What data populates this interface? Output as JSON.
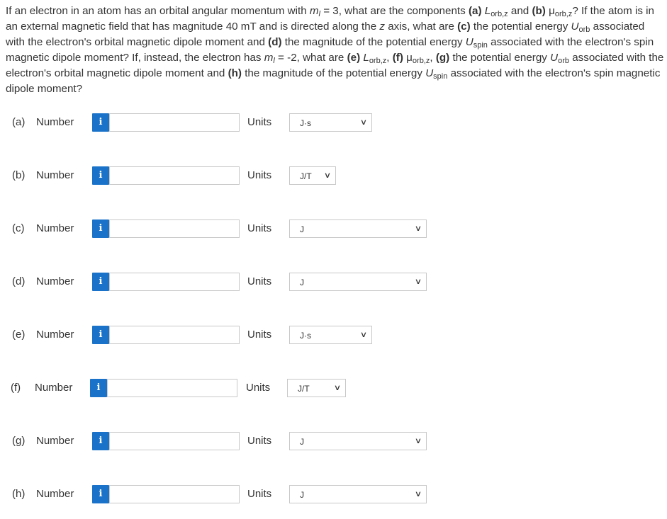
{
  "question": {
    "t1": "If an electron in an atom has an orbital angular momentum with ",
    "ml_sym": "m",
    "ml_sub": "l",
    "t2": " = 3, what are the components ",
    "a": "(a)",
    "L_sym": "L",
    "orbz_sub": "orb,z",
    "t3": " and ",
    "b": "(b)",
    "mu_sym": "μ",
    "t4": "? If the atom is in an external magnetic field that has magnitude 40 mT and is directed along the ",
    "z": "z",
    "t5": " axis, what are ",
    "c": "(c)",
    "t6": " the potential energy ",
    "U_sym": "U",
    "orb_sub": "orb",
    "t7": " associated with the electron's orbital magnetic dipole moment and ",
    "d": "(d)",
    "t8": " the magnitude of the potential energy ",
    "spin_sub": "spin",
    "t9": " associated with the electron's spin magnetic dipole moment? If, instead, the electron has ",
    "t10": " = -2, what are ",
    "e": "(e)",
    "comma": ", ",
    "f": "(f)",
    "g": "(g)",
    "t11": " the potential energy ",
    "t12": " associated with the electron's orbital magnetic dipole moment and ",
    "h": "(h)",
    "t13": " the magnitude of the potential energy ",
    "t14": " associated with the electron's spin magnetic dipole moment?"
  },
  "rows": [
    {
      "part": "(a)",
      "label": "Number",
      "info": "i",
      "value": "",
      "units_label": "Units",
      "unit": "J·s"
    },
    {
      "part": "(b)",
      "label": "Number",
      "info": "i",
      "value": "",
      "units_label": "Units",
      "unit": "J/T"
    },
    {
      "part": "(c)",
      "label": "Number",
      "info": "i",
      "value": "",
      "units_label": "Units",
      "unit": "J"
    },
    {
      "part": "(d)",
      "label": "Number",
      "info": "i",
      "value": "",
      "units_label": "Units",
      "unit": "J"
    },
    {
      "part": "(e)",
      "label": "Number",
      "info": "i",
      "value": "",
      "units_label": "Units",
      "unit": "J·s"
    },
    {
      "part": "(f)",
      "label": "Number",
      "info": "i",
      "value": "",
      "units_label": "Units",
      "unit": "J/T"
    },
    {
      "part": "(g)",
      "label": "Number",
      "info": "i",
      "value": "",
      "units_label": "Units",
      "unit": "J"
    },
    {
      "part": "(h)",
      "label": "Number",
      "info": "i",
      "value": "",
      "units_label": "Units",
      "unit": "J"
    }
  ],
  "icons": {
    "dropdown": "chevron-down-icon",
    "info": "info-icon"
  },
  "colors": {
    "info_button": "#1a73c9",
    "border": "#c8c8c8",
    "text": "#333333"
  }
}
